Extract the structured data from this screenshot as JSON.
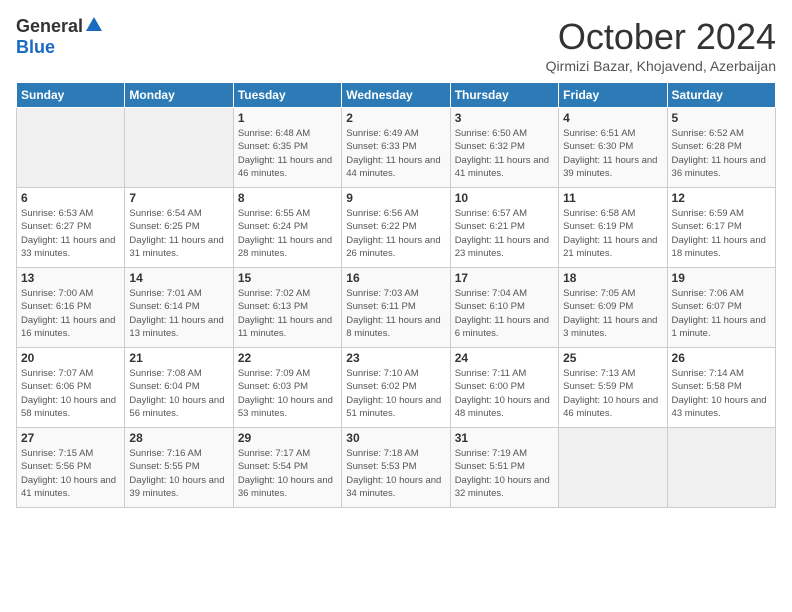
{
  "logo": {
    "general": "General",
    "blue": "Blue"
  },
  "title": "October 2024",
  "location": "Qirmizi Bazar, Khojavend, Azerbaijan",
  "days_of_week": [
    "Sunday",
    "Monday",
    "Tuesday",
    "Wednesday",
    "Thursday",
    "Friday",
    "Saturday"
  ],
  "weeks": [
    [
      {
        "day": "",
        "details": ""
      },
      {
        "day": "",
        "details": ""
      },
      {
        "day": "1",
        "details": "Sunrise: 6:48 AM\nSunset: 6:35 PM\nDaylight: 11 hours and 46 minutes."
      },
      {
        "day": "2",
        "details": "Sunrise: 6:49 AM\nSunset: 6:33 PM\nDaylight: 11 hours and 44 minutes."
      },
      {
        "day": "3",
        "details": "Sunrise: 6:50 AM\nSunset: 6:32 PM\nDaylight: 11 hours and 41 minutes."
      },
      {
        "day": "4",
        "details": "Sunrise: 6:51 AM\nSunset: 6:30 PM\nDaylight: 11 hours and 39 minutes."
      },
      {
        "day": "5",
        "details": "Sunrise: 6:52 AM\nSunset: 6:28 PM\nDaylight: 11 hours and 36 minutes."
      }
    ],
    [
      {
        "day": "6",
        "details": "Sunrise: 6:53 AM\nSunset: 6:27 PM\nDaylight: 11 hours and 33 minutes."
      },
      {
        "day": "7",
        "details": "Sunrise: 6:54 AM\nSunset: 6:25 PM\nDaylight: 11 hours and 31 minutes."
      },
      {
        "day": "8",
        "details": "Sunrise: 6:55 AM\nSunset: 6:24 PM\nDaylight: 11 hours and 28 minutes."
      },
      {
        "day": "9",
        "details": "Sunrise: 6:56 AM\nSunset: 6:22 PM\nDaylight: 11 hours and 26 minutes."
      },
      {
        "day": "10",
        "details": "Sunrise: 6:57 AM\nSunset: 6:21 PM\nDaylight: 11 hours and 23 minutes."
      },
      {
        "day": "11",
        "details": "Sunrise: 6:58 AM\nSunset: 6:19 PM\nDaylight: 11 hours and 21 minutes."
      },
      {
        "day": "12",
        "details": "Sunrise: 6:59 AM\nSunset: 6:17 PM\nDaylight: 11 hours and 18 minutes."
      }
    ],
    [
      {
        "day": "13",
        "details": "Sunrise: 7:00 AM\nSunset: 6:16 PM\nDaylight: 11 hours and 16 minutes."
      },
      {
        "day": "14",
        "details": "Sunrise: 7:01 AM\nSunset: 6:14 PM\nDaylight: 11 hours and 13 minutes."
      },
      {
        "day": "15",
        "details": "Sunrise: 7:02 AM\nSunset: 6:13 PM\nDaylight: 11 hours and 11 minutes."
      },
      {
        "day": "16",
        "details": "Sunrise: 7:03 AM\nSunset: 6:11 PM\nDaylight: 11 hours and 8 minutes."
      },
      {
        "day": "17",
        "details": "Sunrise: 7:04 AM\nSunset: 6:10 PM\nDaylight: 11 hours and 6 minutes."
      },
      {
        "day": "18",
        "details": "Sunrise: 7:05 AM\nSunset: 6:09 PM\nDaylight: 11 hours and 3 minutes."
      },
      {
        "day": "19",
        "details": "Sunrise: 7:06 AM\nSunset: 6:07 PM\nDaylight: 11 hours and 1 minute."
      }
    ],
    [
      {
        "day": "20",
        "details": "Sunrise: 7:07 AM\nSunset: 6:06 PM\nDaylight: 10 hours and 58 minutes."
      },
      {
        "day": "21",
        "details": "Sunrise: 7:08 AM\nSunset: 6:04 PM\nDaylight: 10 hours and 56 minutes."
      },
      {
        "day": "22",
        "details": "Sunrise: 7:09 AM\nSunset: 6:03 PM\nDaylight: 10 hours and 53 minutes."
      },
      {
        "day": "23",
        "details": "Sunrise: 7:10 AM\nSunset: 6:02 PM\nDaylight: 10 hours and 51 minutes."
      },
      {
        "day": "24",
        "details": "Sunrise: 7:11 AM\nSunset: 6:00 PM\nDaylight: 10 hours and 48 minutes."
      },
      {
        "day": "25",
        "details": "Sunrise: 7:13 AM\nSunset: 5:59 PM\nDaylight: 10 hours and 46 minutes."
      },
      {
        "day": "26",
        "details": "Sunrise: 7:14 AM\nSunset: 5:58 PM\nDaylight: 10 hours and 43 minutes."
      }
    ],
    [
      {
        "day": "27",
        "details": "Sunrise: 7:15 AM\nSunset: 5:56 PM\nDaylight: 10 hours and 41 minutes."
      },
      {
        "day": "28",
        "details": "Sunrise: 7:16 AM\nSunset: 5:55 PM\nDaylight: 10 hours and 39 minutes."
      },
      {
        "day": "29",
        "details": "Sunrise: 7:17 AM\nSunset: 5:54 PM\nDaylight: 10 hours and 36 minutes."
      },
      {
        "day": "30",
        "details": "Sunrise: 7:18 AM\nSunset: 5:53 PM\nDaylight: 10 hours and 34 minutes."
      },
      {
        "day": "31",
        "details": "Sunrise: 7:19 AM\nSunset: 5:51 PM\nDaylight: 10 hours and 32 minutes."
      },
      {
        "day": "",
        "details": ""
      },
      {
        "day": "",
        "details": ""
      }
    ]
  ]
}
